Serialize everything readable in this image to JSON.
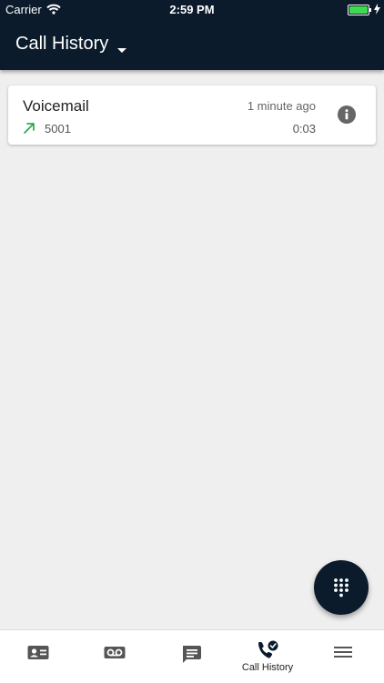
{
  "status_bar": {
    "carrier": "Carrier",
    "time": "2:59 PM",
    "battery_color": "#3ddc4e"
  },
  "app_bar": {
    "title": "Call History",
    "background": "#0b1b2c"
  },
  "call_history": [
    {
      "name": "Voicemail",
      "time_ago": "1 minute ago",
      "number": "5001",
      "duration": "0:03",
      "direction": "outgoing",
      "direction_icon": "outgoing-call-arrow-icon",
      "direction_color": "#2ea84a"
    }
  ],
  "fab": {
    "icon": "dialpad-icon"
  },
  "bottom_nav": {
    "items": [
      {
        "icon": "contacts-icon"
      },
      {
        "icon": "voicemail-icon"
      },
      {
        "icon": "messages-icon"
      },
      {
        "icon": "call-history-icon",
        "label": "Call History",
        "active": true
      },
      {
        "icon": "menu-icon"
      }
    ]
  }
}
